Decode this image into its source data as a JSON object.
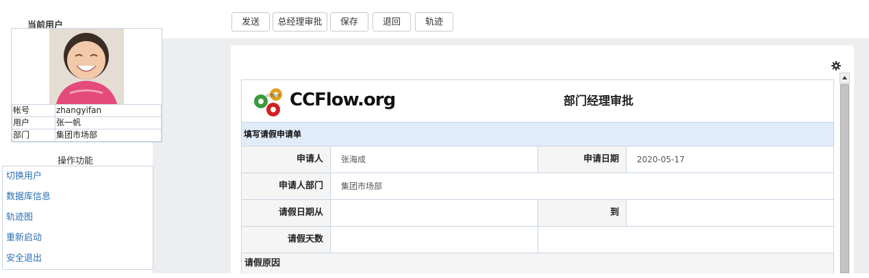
{
  "left": {
    "title": "当前用户",
    "info": [
      {
        "key": "帐号",
        "value": "zhangyifan"
      },
      {
        "key": "用户",
        "value": "张一帆"
      },
      {
        "key": "部门",
        "value": "集团市场部"
      }
    ],
    "ops_title": "操作功能",
    "ops": [
      "切换用户",
      "数据库信息",
      "轨迹图",
      "重新启动",
      "安全退出"
    ]
  },
  "toolbar": {
    "send": "发送",
    "gm_approve": "总经理审批",
    "save": "保存",
    "return": "退回",
    "track": "轨迹"
  },
  "form": {
    "logo_text": "CCFlow.org",
    "logo_small": "ccbpm",
    "title": "部门经理审批",
    "section": "填写请假申请单",
    "applicant_label": "申请人",
    "applicant": "张海成",
    "apply_date_label": "申请日期",
    "apply_date": "2020-05-17",
    "dept_label": "申请人部门",
    "dept": "集团市场部",
    "leave_from_label": "请假日期从",
    "leave_from": "",
    "leave_to_label": "到",
    "leave_to": "",
    "days_label": "请假天数",
    "days": "",
    "reason_label": "请假原因"
  },
  "icons": {
    "settings": "gear-icon",
    "scroll_up": "triangle-up-icon"
  },
  "colors": {
    "link": "#2a6db3",
    "section_bg": "#e0ecfa",
    "page_bg": "#eceeef"
  }
}
